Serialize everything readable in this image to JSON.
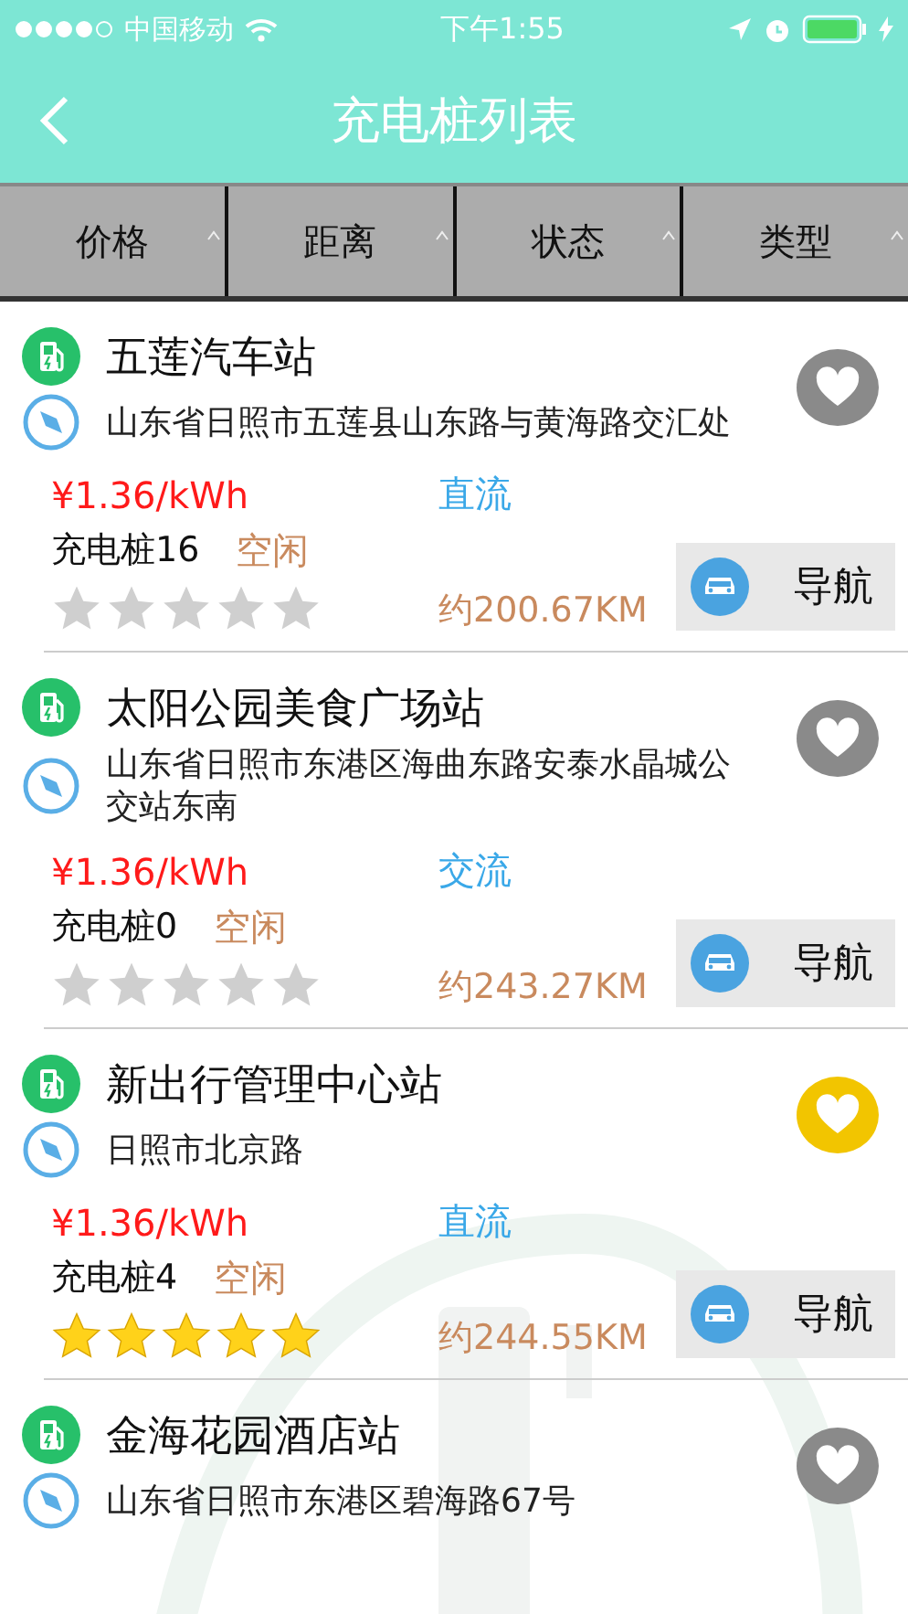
{
  "status_bar": {
    "carrier": "中国移动",
    "time": "下午1:55"
  },
  "nav": {
    "title": "充电桩列表"
  },
  "filters": [
    {
      "label": "价格"
    },
    {
      "label": "距离"
    },
    {
      "label": "状态"
    },
    {
      "label": "类型"
    }
  ],
  "stations": [
    {
      "name": "五莲汽车站",
      "address": "山东省日照市五莲县山东路与黄海路交汇处",
      "price": "¥1.36/kWh",
      "current_type": "直流",
      "piles": "充电桩16",
      "status": "空闲",
      "stars": 0,
      "distance": "约200.67KM",
      "nav_label": "导航",
      "favorite": false
    },
    {
      "name": "太阳公园美食广场站",
      "address": "山东省日照市东港区海曲东路安泰水晶城公交站东南",
      "price": "¥1.36/kWh",
      "current_type": "交流",
      "piles": "充电桩0",
      "status": "空闲",
      "stars": 0,
      "distance": "约243.27KM",
      "nav_label": "导航",
      "favorite": false
    },
    {
      "name": "新出行管理中心站",
      "address": "日照市北京路",
      "price": "¥1.36/kWh",
      "current_type": "直流",
      "piles": "充电桩4",
      "status": "空闲",
      "stars": 5,
      "distance": "约244.55KM",
      "nav_label": "导航",
      "favorite": true
    },
    {
      "name": "金海花园酒店站",
      "address": "山东省日照市东港区碧海路67号",
      "favorite": false
    }
  ]
}
